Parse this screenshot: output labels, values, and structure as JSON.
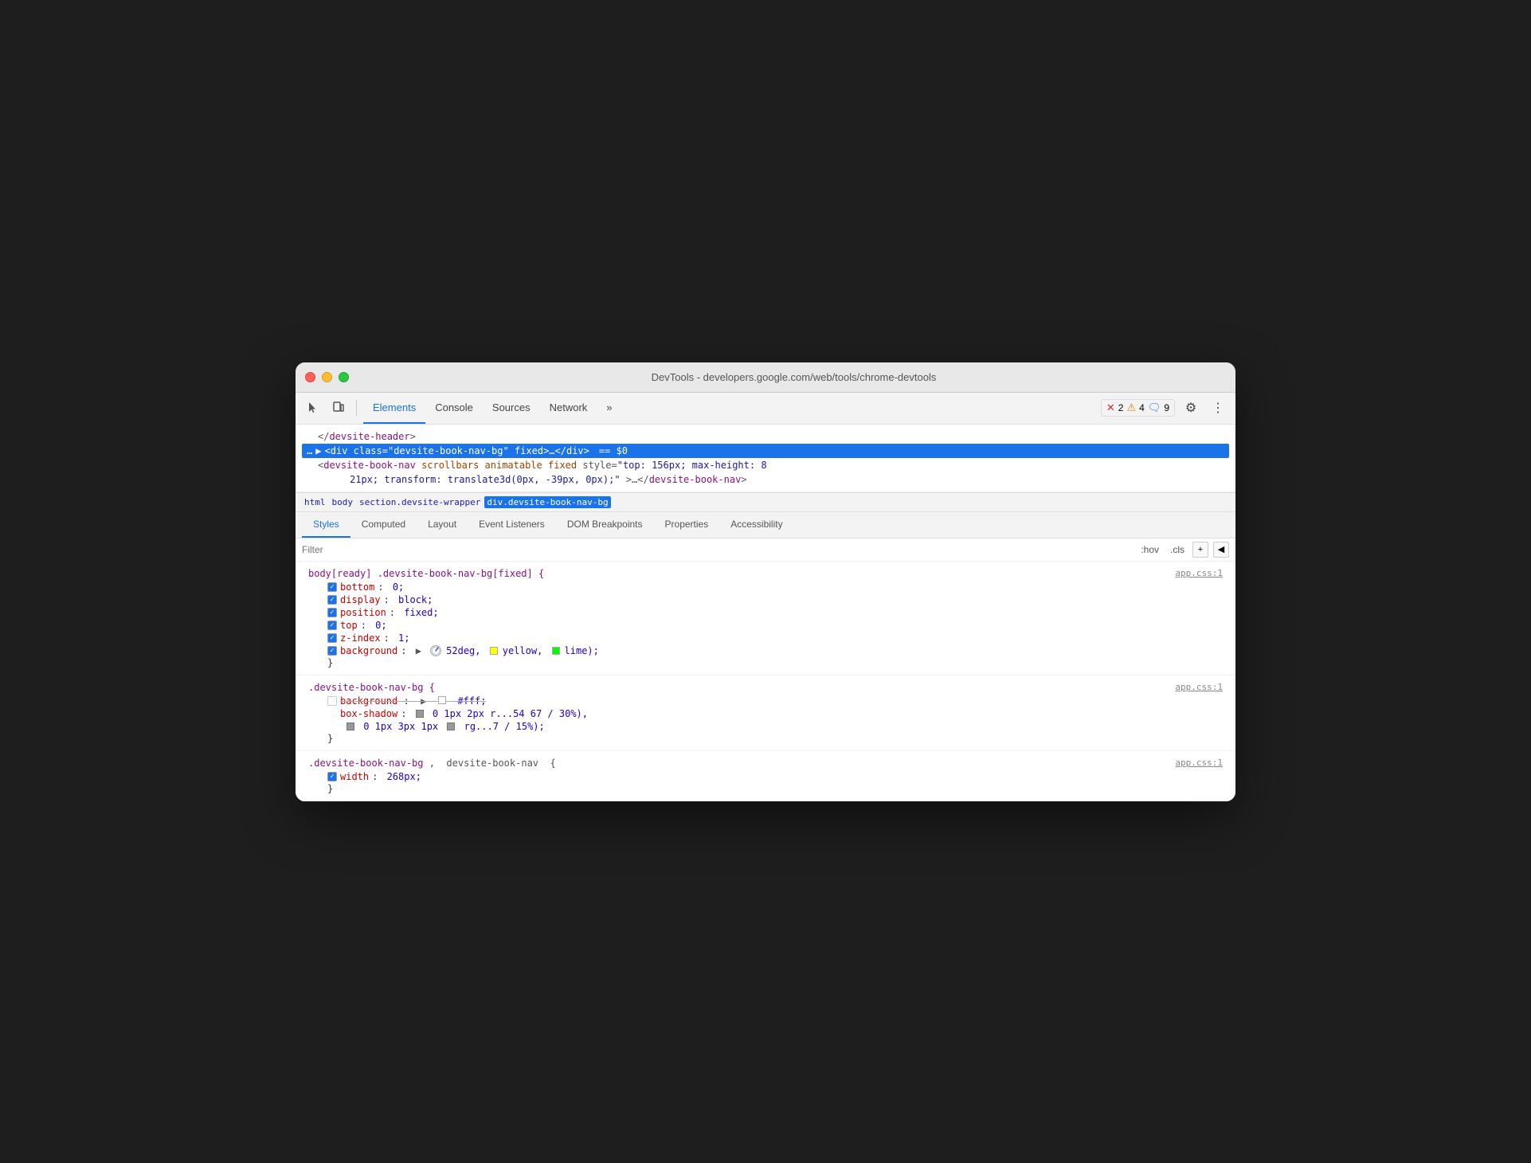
{
  "window": {
    "title": "DevTools - developers.google.com/web/tools/chrome-devtools"
  },
  "toolbar": {
    "tabs": [
      {
        "label": "Elements",
        "active": true
      },
      {
        "label": "Console",
        "active": false
      },
      {
        "label": "Sources",
        "active": false
      },
      {
        "label": "Network",
        "active": false
      },
      {
        "label": "»",
        "active": false
      }
    ],
    "error_badge": "✕ 2",
    "warning_badge": "⚠ 4",
    "info_badge": "🗨 9"
  },
  "dom": {
    "line1": "</devsite-header>",
    "line2_prefix": "▶",
    "line2_tag": "<div class=\"devsite-book-nav-bg\"",
    "line2_attr": "fixed",
    "line2_suffix": ">…</div>",
    "line2_dollar": "== $0",
    "line3": "<devsite-book-nav scrollbars animatable fixed style=\"top: 156px; max-height: 8",
    "line4": "21px; transform: translate3d(0px, -39px, 0px);\">…</devsite-book-nav>"
  },
  "breadcrumb": {
    "items": [
      "html",
      "body",
      "section.devsite-wrapper",
      "div.devsite-book-nav-bg"
    ],
    "active_index": 3
  },
  "panel_tabs": {
    "tabs": [
      {
        "label": "Styles",
        "active": true
      },
      {
        "label": "Computed",
        "active": false
      },
      {
        "label": "Layout",
        "active": false
      },
      {
        "label": "Event Listeners",
        "active": false
      },
      {
        "label": "DOM Breakpoints",
        "active": false
      },
      {
        "label": "Properties",
        "active": false
      },
      {
        "label": "Accessibility",
        "active": false
      }
    ]
  },
  "filter": {
    "placeholder": "Filter",
    "hov_label": ":hov",
    "cls_label": ".cls"
  },
  "css_rules": [
    {
      "selector": "body[ready] .devsite-book-nav-bg[fixed] {",
      "link": "app.css:1",
      "properties": [
        {
          "name": "bottom",
          "value": "0;",
          "checked": true,
          "strikethrough": false
        },
        {
          "name": "display",
          "value": "block;",
          "checked": true,
          "strikethrough": false
        },
        {
          "name": "position",
          "value": "fixed;",
          "checked": true,
          "strikethrough": false
        },
        {
          "name": "top",
          "value": "0;",
          "checked": true,
          "strikethrough": false
        },
        {
          "name": "z-index",
          "value": "1;",
          "checked": true,
          "strikethrough": false
        },
        {
          "name": "background",
          "value": "▶ linear-gradient(◷52deg, yellow, lime);",
          "checked": true,
          "strikethrough": false,
          "has_gradient": true
        }
      ]
    },
    {
      "selector": ".devsite-book-nav-bg {",
      "link": "app.css:1",
      "properties": [
        {
          "name": "background",
          "value": "▶ □ #fff;",
          "checked": false,
          "strikethrough": true
        },
        {
          "name": "box-shadow",
          "value": "□ 0 1px 2px r...54 67 / 30%),",
          "checked": false,
          "strikethrough": false
        },
        {
          "name": "box-shadow2",
          "value": "□ 0 1px 3px 1px □ rg...7 / 15%);",
          "checked": false,
          "strikethrough": false
        }
      ]
    },
    {
      "selector": ".devsite-book-nav-bg, devsite-book-nav {",
      "link": "app.css:1",
      "properties": [
        {
          "name": "width",
          "value": "268px;",
          "checked": true,
          "strikethrough": false
        }
      ]
    }
  ]
}
